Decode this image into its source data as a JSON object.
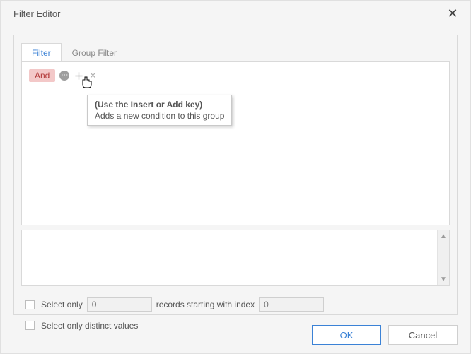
{
  "dialog": {
    "title": "Filter Editor"
  },
  "tabs": {
    "filter": "Filter",
    "group": "Group Filter"
  },
  "condition": {
    "operator": "And"
  },
  "tooltip": {
    "title": "(Use the Insert or Add key)",
    "body": "Adds a new condition to this group"
  },
  "options": {
    "select_only_label_left": "Select only",
    "select_only_records_value": "0",
    "select_only_label_mid": "records starting with index",
    "select_only_index_value": "0",
    "distinct_label": "Select only distinct values"
  },
  "buttons": {
    "ok": "OK",
    "cancel": "Cancel"
  }
}
